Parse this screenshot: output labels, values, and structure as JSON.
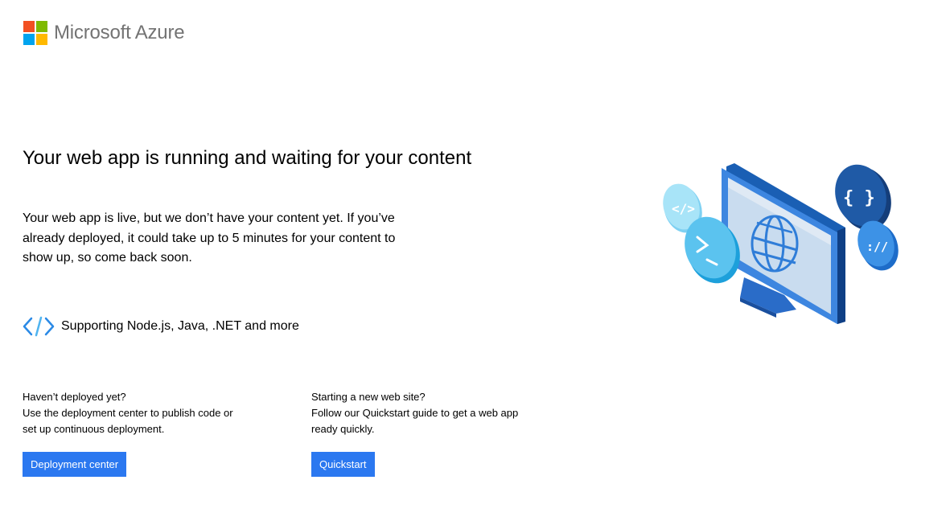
{
  "header": {
    "brand": "Microsoft Azure",
    "logo_colors": [
      "#f25022",
      "#7fba00",
      "#00a4ef",
      "#ffb900"
    ]
  },
  "main": {
    "headline": "Your web app is running and waiting for your content",
    "intro": "Your web app is live, but we don’t have your content yet. If you’ve already deployed, it could take up to 5 minutes for your content to show up, so come back soon.",
    "support_label": "Supporting Node.js, Java, .NET and more",
    "support_icon": "code-brackets-icon"
  },
  "deploy": {
    "line1": "Haven’t deployed yet?",
    "line2": "Use the deployment center to publish code or set up continuous deployment.",
    "button_label": "Deployment center"
  },
  "quickstart": {
    "line1": "Starting a new web site?",
    "line2": "Follow our Quickstart guide to get a web app ready quickly.",
    "button_label": "Quickstart"
  },
  "theme": {
    "accent": "#2b78f0",
    "illustration_primary": "#1f6fd1"
  }
}
